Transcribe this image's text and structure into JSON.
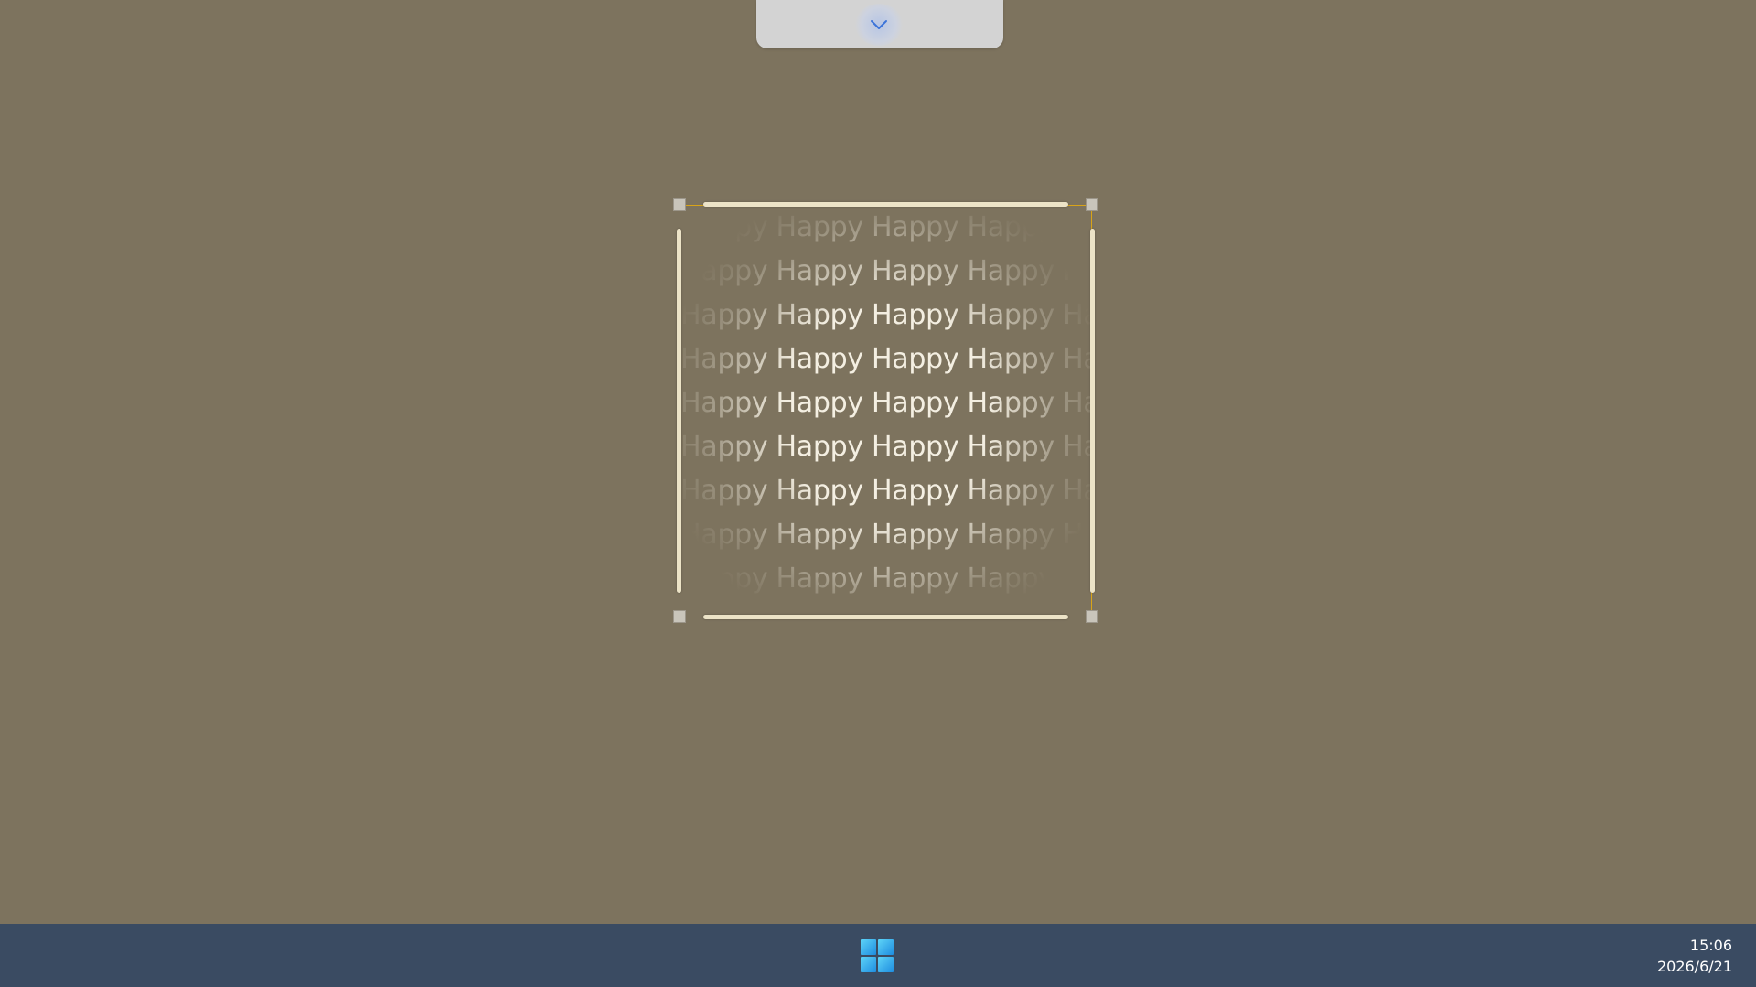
{
  "snip_toolbar": {
    "expand_icon": "chevron-down-icon",
    "accent": "#3b73d9"
  },
  "selection": {
    "border_color": "#d9a418",
    "rows": [
      "Happy Happy Happy Happy Happy",
      "Happy Happy Happy Happy Happy",
      "Happy Happy Happy Happy Happy",
      "Happy Happy Happy Happy Happy",
      "Happy Happy Happy Happy Happy",
      "Happy Happy Happy Happy Happy",
      "Happy Happy Happy Happy Happy",
      "Happy Happy Happy Happy Happy",
      "Happy Happy Happy Happy Happy"
    ]
  },
  "taskbar": {
    "start_icon": "windows-logo-icon",
    "time": "15:06",
    "date": "2026/6/21"
  },
  "colors": {
    "desktop": "#7d735e",
    "taskbar": "#3a4b62",
    "toolbar": "#d3d3d3"
  }
}
